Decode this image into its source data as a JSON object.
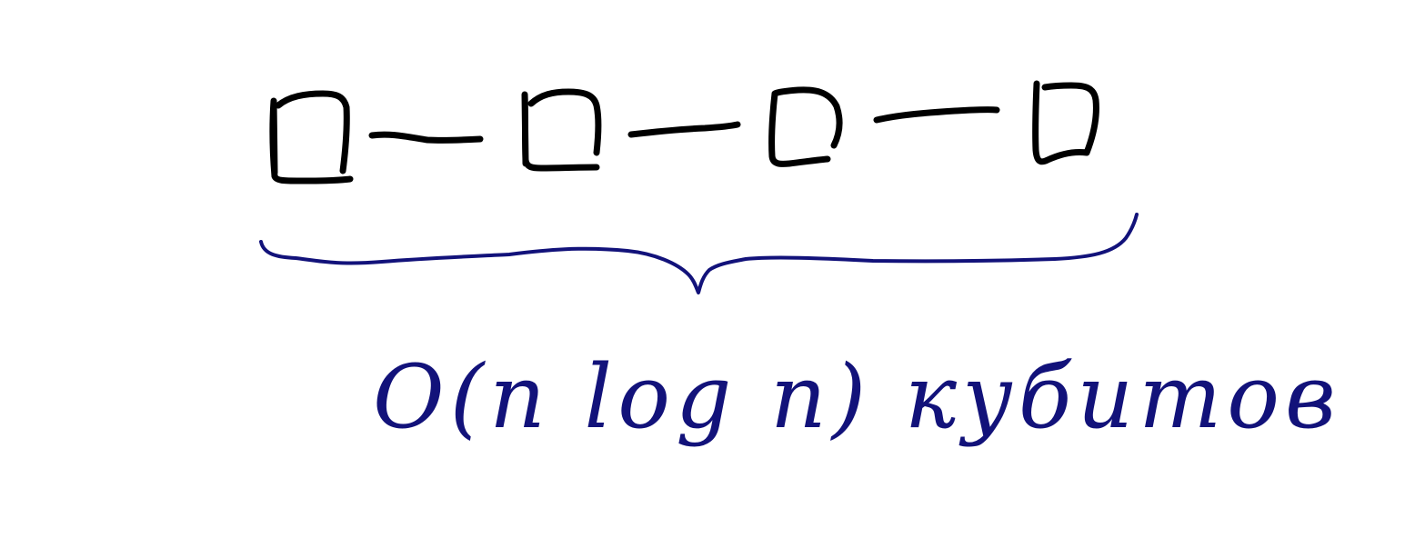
{
  "diagram": {
    "qubits": [
      {
        "id": "qubit-1"
      },
      {
        "id": "qubit-2"
      },
      {
        "id": "qubit-3"
      },
      {
        "id": "qubit-4"
      }
    ],
    "links": [
      {
        "from": "qubit-1",
        "to": "qubit-2"
      },
      {
        "from": "qubit-2",
        "to": "qubit-3"
      },
      {
        "from": "qubit-3",
        "to": "qubit-4"
      }
    ],
    "brace": {
      "spans": [
        "qubit-1",
        "qubit-4"
      ]
    },
    "annotation": "O(n log n) кубитов"
  },
  "colors": {
    "qubit_ink": "#000000",
    "annotation_ink": "#12127a",
    "background": "#ffffff"
  }
}
